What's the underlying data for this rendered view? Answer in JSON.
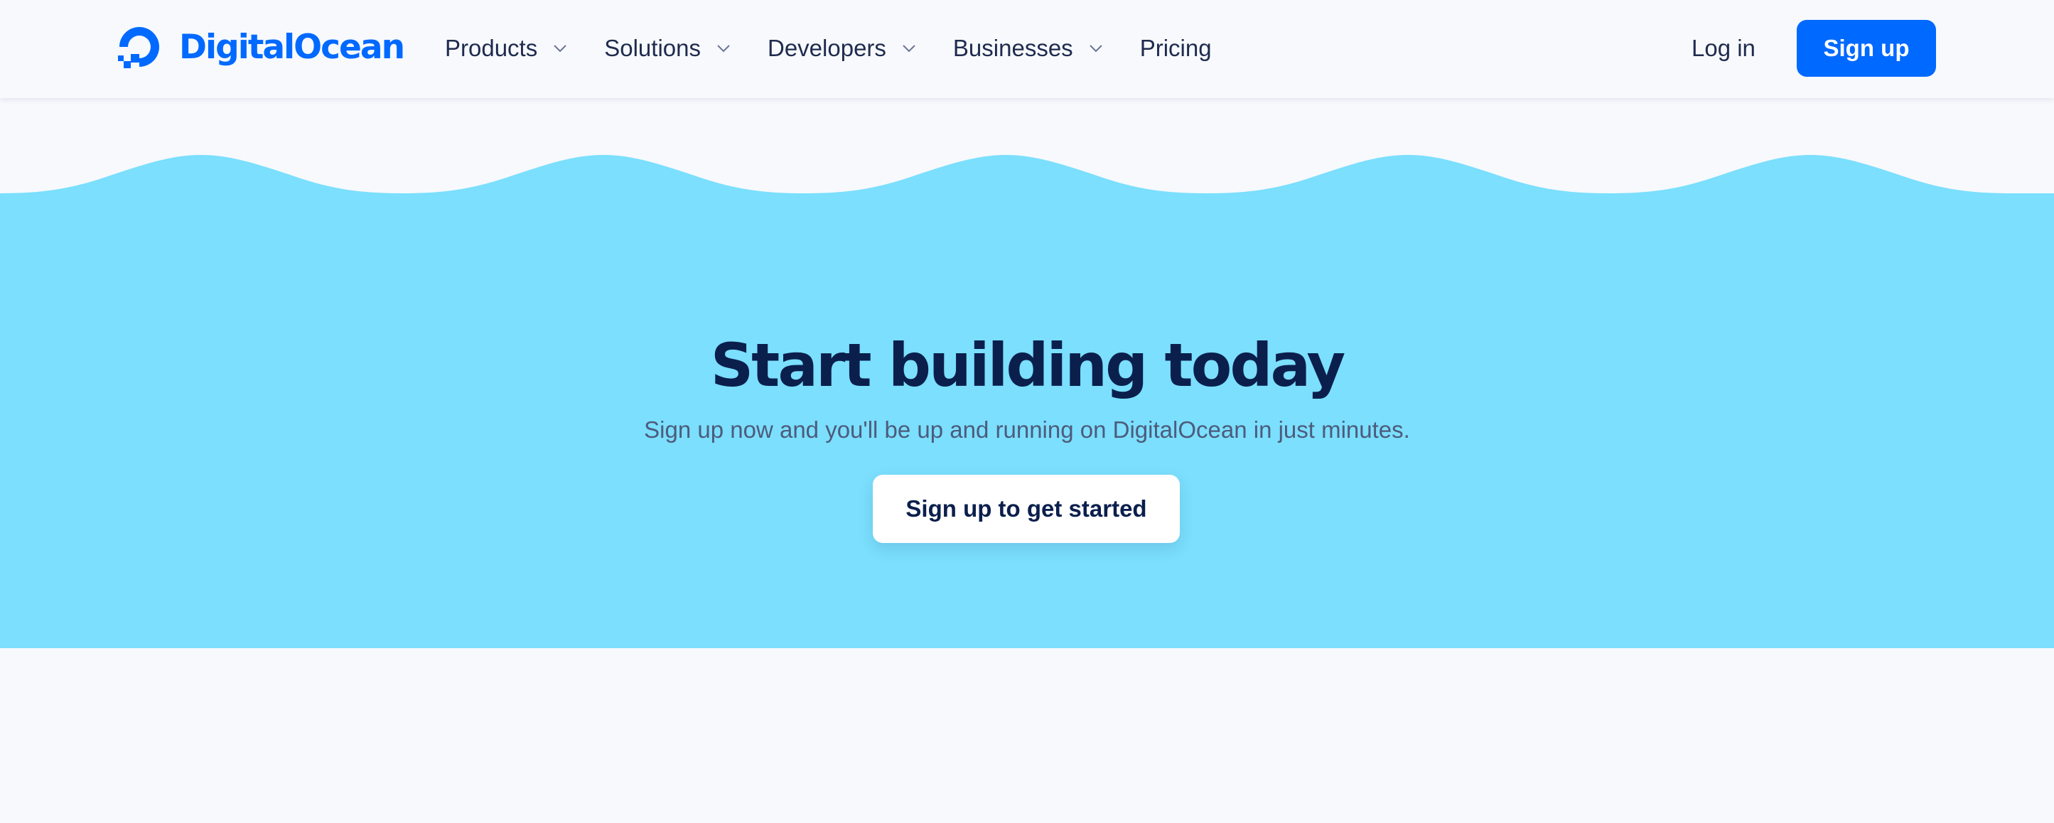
{
  "brand": {
    "name": "DigitalOcean",
    "logo_icon": "digitalocean-logo-icon",
    "color": "#0069ff"
  },
  "nav": {
    "items": [
      {
        "label": "Products",
        "has_dropdown": true
      },
      {
        "label": "Solutions",
        "has_dropdown": true
      },
      {
        "label": "Developers",
        "has_dropdown": true
      },
      {
        "label": "Businesses",
        "has_dropdown": true
      },
      {
        "label": "Pricing",
        "has_dropdown": false
      }
    ],
    "dropdown_icon": "chevron-down-icon"
  },
  "header": {
    "login_label": "Log in",
    "signup_label": "Sign up"
  },
  "hero": {
    "title": "Start building today",
    "subtitle": "Sign up now and you'll be up and running on DigitalOcean in just minutes.",
    "cta_label": "Sign up to get started",
    "background_color": "#7bdffd"
  },
  "colors": {
    "page_background": "#f7f9fd",
    "primary_button": "#0069ff",
    "heading_text": "#0b1f4d"
  }
}
